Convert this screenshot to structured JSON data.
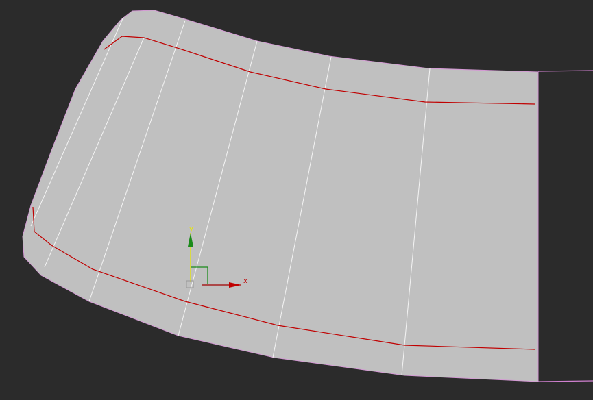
{
  "viewport": {
    "gizmo": {
      "x_label": "x",
      "y_label": "y"
    },
    "colors": {
      "background": "#2b2b2b",
      "mesh": "#c0c0c0",
      "edge": "#ffffff",
      "seam": "#c00000",
      "border": "#e080e0",
      "x_axis": "#c00000",
      "y_axis": "#e0e000",
      "y_arrow": "#1a8a1a"
    }
  }
}
